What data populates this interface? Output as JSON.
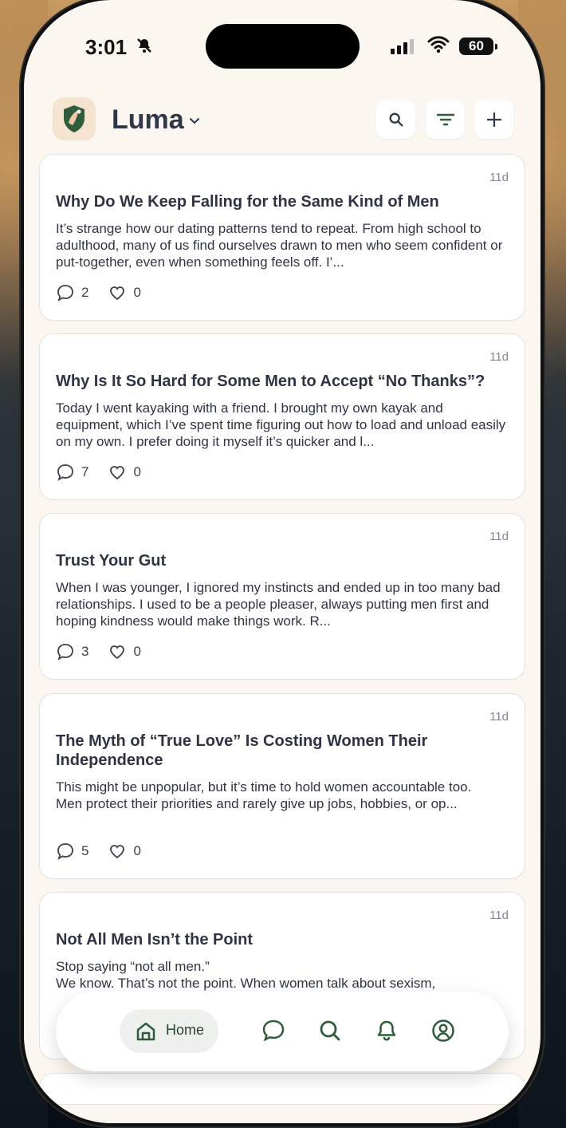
{
  "status": {
    "time": "3:01",
    "battery": "60"
  },
  "header": {
    "brand": "Luma"
  },
  "posts": [
    {
      "age": "11d",
      "title": "Why Do We Keep Falling for the Same Kind of Men",
      "body": "It’s strange how our dating patterns tend to repeat. From high school to adulthood, many of us find ourselves drawn to men who seem confident or put-together, even when something feels off. I’...",
      "comments": "2",
      "likes": "0"
    },
    {
      "age": "11d",
      "title": "Why Is It So Hard for Some Men to Accept “No Thanks”?",
      "body": "Today I went kayaking with a friend. I brought my own kayak and equipment, which I’ve spent time figuring out how to load and unload easily on my own. I prefer doing it myself it’s quicker and l...",
      "comments": "7",
      "likes": "0"
    },
    {
      "age": "11d",
      "title": "Trust Your Gut",
      "body": "When I was younger, I ignored my instincts and ended up in too many bad relationships. I used to be a people pleaser, always putting men first and hoping kindness would make things work. R...",
      "comments": "3",
      "likes": "0"
    },
    {
      "age": "11d",
      "title": "The Myth of “True Love” Is Costing Women Their Independence",
      "body": "This might be unpopular, but it’s time to hold women accountable too.\nMen protect their priorities and rarely give up jobs, hobbies, or op...",
      "comments": "5",
      "likes": "0"
    },
    {
      "age": "11d",
      "title": "Not All Men Isn’t the Point",
      "body": "Stop saying “not all men.”\nWe know. That’s not the point. When women talk about sexism,",
      "comments": "",
      "likes": ""
    }
  ],
  "tabbar": {
    "home": "Home"
  },
  "colors": {
    "background": "#fbf6ef",
    "accent": "#2f5d3c",
    "text": "#2f3445",
    "muted": "#7f8696"
  },
  "icons": {
    "search": "search-icon",
    "filter": "filter-icon",
    "add": "plus-icon",
    "comment": "comment-icon",
    "like": "heart-icon",
    "home": "home-icon",
    "messages": "chat-icon",
    "explore": "search-icon",
    "notifications": "bell-icon",
    "profile": "profile-icon"
  }
}
